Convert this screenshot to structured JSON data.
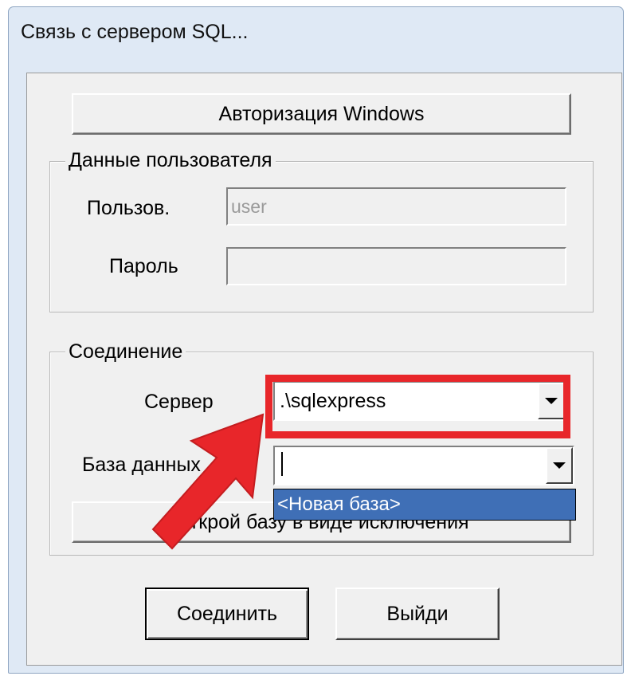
{
  "window": {
    "title": "Связь с сервером SQL...",
    "accent_color": "#3f6fb6",
    "highlight_color": "#e8262a"
  },
  "auth_button": {
    "label": "Авторизация Windows"
  },
  "user_group": {
    "legend": "Данные пользователя",
    "user_label": "Пользов.",
    "user_value": "user",
    "password_label": "Пароль",
    "password_value": ""
  },
  "connection_group": {
    "legend": "Соединение",
    "server_label": "Сервер",
    "server_value": ".\\sqlexpress",
    "database_label": "База данных",
    "database_value": "",
    "dropdown_options": [
      "<Новая база>"
    ]
  },
  "exclusive_button": {
    "label": "Открой базу в виде исключения"
  },
  "footer": {
    "connect_label": "Соединить",
    "exit_label": "Выйди"
  },
  "icons": {
    "dropdown": "chevron-down-icon",
    "annotation_arrow": "arrow-icon"
  }
}
